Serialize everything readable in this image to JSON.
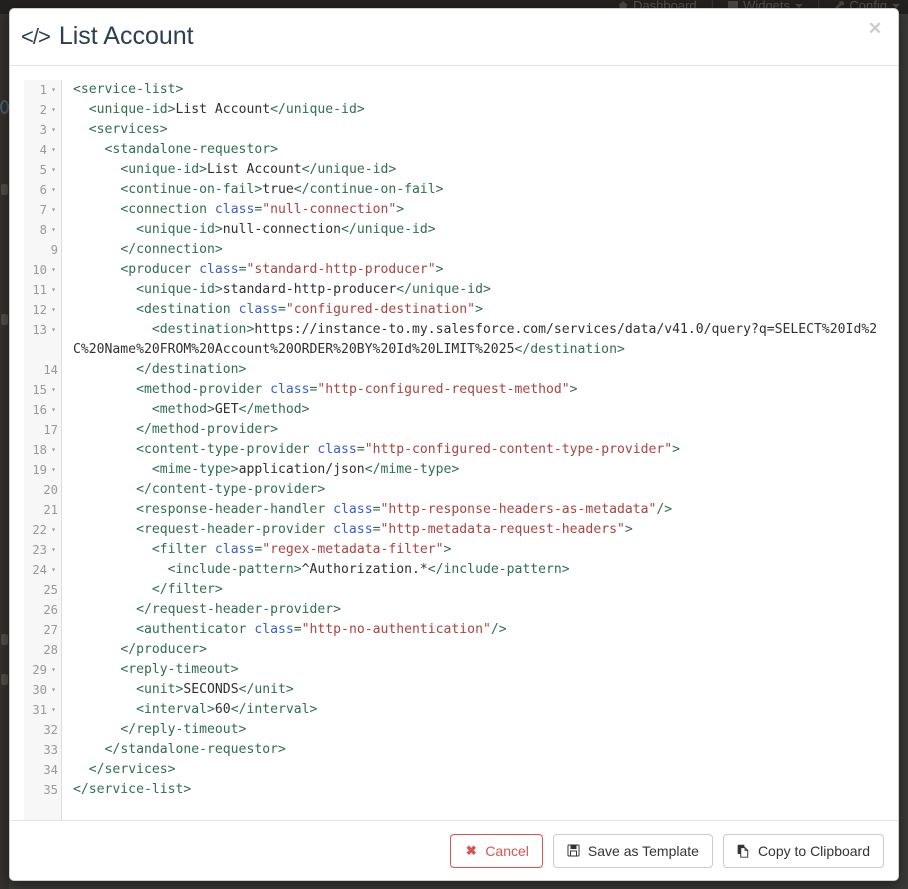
{
  "background": {
    "nav_items": [
      {
        "label": "Dashboard",
        "icon": "home-icon"
      },
      {
        "label": "Widgets",
        "icon": "widgets-icon"
      },
      {
        "label": "Config",
        "icon": "wrench-icon"
      }
    ],
    "separator": "|"
  },
  "modal": {
    "title": "List Account",
    "title_icon": "</>",
    "close_label": "✕"
  },
  "editor": {
    "language": "xml",
    "total_lines": 35,
    "lines": [
      {
        "n": 1,
        "fold": true,
        "indent": 0,
        "tokens": [
          {
            "t": "tag",
            "v": "<service-list>"
          }
        ]
      },
      {
        "n": 2,
        "fold": true,
        "indent": 1,
        "tokens": [
          {
            "t": "tag",
            "v": "<unique-id>"
          },
          {
            "t": "txt",
            "v": "List Account"
          },
          {
            "t": "tag",
            "v": "</unique-id>"
          }
        ]
      },
      {
        "n": 3,
        "fold": true,
        "indent": 1,
        "tokens": [
          {
            "t": "tag",
            "v": "<services>"
          }
        ]
      },
      {
        "n": 4,
        "fold": true,
        "indent": 2,
        "tokens": [
          {
            "t": "tag",
            "v": "<standalone-requestor>"
          }
        ]
      },
      {
        "n": 5,
        "fold": true,
        "indent": 3,
        "tokens": [
          {
            "t": "tag",
            "v": "<unique-id>"
          },
          {
            "t": "txt",
            "v": "List Account"
          },
          {
            "t": "tag",
            "v": "</unique-id>"
          }
        ]
      },
      {
        "n": 6,
        "fold": true,
        "indent": 3,
        "tokens": [
          {
            "t": "tag",
            "v": "<continue-on-fail>"
          },
          {
            "t": "txt",
            "v": "true"
          },
          {
            "t": "tag",
            "v": "</continue-on-fail>"
          }
        ]
      },
      {
        "n": 7,
        "fold": true,
        "indent": 3,
        "tokens": [
          {
            "t": "tag",
            "v": "<connection "
          },
          {
            "t": "attr",
            "v": "class"
          },
          {
            "t": "punc",
            "v": "="
          },
          {
            "t": "str",
            "v": "\"null-connection\""
          },
          {
            "t": "tag",
            "v": ">"
          }
        ]
      },
      {
        "n": 8,
        "fold": true,
        "indent": 4,
        "tokens": [
          {
            "t": "tag",
            "v": "<unique-id>"
          },
          {
            "t": "txt",
            "v": "null-connection"
          },
          {
            "t": "tag",
            "v": "</unique-id>"
          }
        ]
      },
      {
        "n": 9,
        "fold": false,
        "indent": 3,
        "tokens": [
          {
            "t": "tag",
            "v": "</connection>"
          }
        ]
      },
      {
        "n": 10,
        "fold": true,
        "indent": 3,
        "tokens": [
          {
            "t": "tag",
            "v": "<producer "
          },
          {
            "t": "attr",
            "v": "class"
          },
          {
            "t": "punc",
            "v": "="
          },
          {
            "t": "str",
            "v": "\"standard-http-producer\""
          },
          {
            "t": "tag",
            "v": ">"
          }
        ]
      },
      {
        "n": 11,
        "fold": true,
        "indent": 4,
        "tokens": [
          {
            "t": "tag",
            "v": "<unique-id>"
          },
          {
            "t": "txt",
            "v": "standard-http-producer"
          },
          {
            "t": "tag",
            "v": "</unique-id>"
          }
        ]
      },
      {
        "n": 12,
        "fold": true,
        "indent": 4,
        "tokens": [
          {
            "t": "tag",
            "v": "<destination "
          },
          {
            "t": "attr",
            "v": "class"
          },
          {
            "t": "punc",
            "v": "="
          },
          {
            "t": "str",
            "v": "\"configured-destination\""
          },
          {
            "t": "tag",
            "v": ">"
          }
        ]
      },
      {
        "n": 13,
        "fold": true,
        "indent": 5,
        "wraps": 2,
        "tokens": [
          {
            "t": "tag",
            "v": "<destination>"
          },
          {
            "t": "txt",
            "v": "https://instance-to.my.salesforce.com/services/data/v41.0/query?q=SELECT%20Id%2C%20Name%20FROM%20Account%20ORDER%20BY%20Id%20LIMIT%2025"
          },
          {
            "t": "tag",
            "v": "</destination>"
          }
        ]
      },
      {
        "n": 14,
        "fold": false,
        "indent": 4,
        "tokens": [
          {
            "t": "tag",
            "v": "</destination>"
          }
        ]
      },
      {
        "n": 15,
        "fold": true,
        "indent": 4,
        "tokens": [
          {
            "t": "tag",
            "v": "<method-provider "
          },
          {
            "t": "attr",
            "v": "class"
          },
          {
            "t": "punc",
            "v": "="
          },
          {
            "t": "str",
            "v": "\"http-configured-request-method\""
          },
          {
            "t": "tag",
            "v": ">"
          }
        ]
      },
      {
        "n": 16,
        "fold": true,
        "indent": 5,
        "tokens": [
          {
            "t": "tag",
            "v": "<method>"
          },
          {
            "t": "txt",
            "v": "GET"
          },
          {
            "t": "tag",
            "v": "</method>"
          }
        ]
      },
      {
        "n": 17,
        "fold": false,
        "indent": 4,
        "tokens": [
          {
            "t": "tag",
            "v": "</method-provider>"
          }
        ]
      },
      {
        "n": 18,
        "fold": true,
        "indent": 4,
        "tokens": [
          {
            "t": "tag",
            "v": "<content-type-provider "
          },
          {
            "t": "attr",
            "v": "class"
          },
          {
            "t": "punc",
            "v": "="
          },
          {
            "t": "str",
            "v": "\"http-configured-content-type-provider\""
          },
          {
            "t": "tag",
            "v": ">"
          }
        ]
      },
      {
        "n": 19,
        "fold": true,
        "indent": 5,
        "tokens": [
          {
            "t": "tag",
            "v": "<mime-type>"
          },
          {
            "t": "txt",
            "v": "application/json"
          },
          {
            "t": "tag",
            "v": "</mime-type>"
          }
        ]
      },
      {
        "n": 20,
        "fold": false,
        "indent": 4,
        "tokens": [
          {
            "t": "tag",
            "v": "</content-type-provider>"
          }
        ]
      },
      {
        "n": 21,
        "fold": false,
        "indent": 4,
        "tokens": [
          {
            "t": "tag",
            "v": "<response-header-handler "
          },
          {
            "t": "attr",
            "v": "class"
          },
          {
            "t": "punc",
            "v": "="
          },
          {
            "t": "str",
            "v": "\"http-response-headers-as-metadata\""
          },
          {
            "t": "tag",
            "v": "/>"
          }
        ]
      },
      {
        "n": 22,
        "fold": true,
        "indent": 4,
        "tokens": [
          {
            "t": "tag",
            "v": "<request-header-provider "
          },
          {
            "t": "attr",
            "v": "class"
          },
          {
            "t": "punc",
            "v": "="
          },
          {
            "t": "str",
            "v": "\"http-metadata-request-headers\""
          },
          {
            "t": "tag",
            "v": ">"
          }
        ]
      },
      {
        "n": 23,
        "fold": true,
        "indent": 5,
        "tokens": [
          {
            "t": "tag",
            "v": "<filter "
          },
          {
            "t": "attr",
            "v": "class"
          },
          {
            "t": "punc",
            "v": "="
          },
          {
            "t": "str",
            "v": "\"regex-metadata-filter\""
          },
          {
            "t": "tag",
            "v": ">"
          }
        ]
      },
      {
        "n": 24,
        "fold": true,
        "indent": 6,
        "tokens": [
          {
            "t": "tag",
            "v": "<include-pattern>"
          },
          {
            "t": "txt",
            "v": "^Authorization.*"
          },
          {
            "t": "tag",
            "v": "</include-pattern>"
          }
        ]
      },
      {
        "n": 25,
        "fold": false,
        "indent": 5,
        "tokens": [
          {
            "t": "tag",
            "v": "</filter>"
          }
        ]
      },
      {
        "n": 26,
        "fold": false,
        "indent": 4,
        "tokens": [
          {
            "t": "tag",
            "v": "</request-header-provider>"
          }
        ]
      },
      {
        "n": 27,
        "fold": false,
        "indent": 4,
        "tokens": [
          {
            "t": "tag",
            "v": "<authenticator "
          },
          {
            "t": "attr",
            "v": "class"
          },
          {
            "t": "punc",
            "v": "="
          },
          {
            "t": "str",
            "v": "\"http-no-authentication\""
          },
          {
            "t": "tag",
            "v": "/>"
          }
        ]
      },
      {
        "n": 28,
        "fold": false,
        "indent": 3,
        "tokens": [
          {
            "t": "tag",
            "v": "</producer>"
          }
        ]
      },
      {
        "n": 29,
        "fold": true,
        "indent": 3,
        "tokens": [
          {
            "t": "tag",
            "v": "<reply-timeout>"
          }
        ]
      },
      {
        "n": 30,
        "fold": true,
        "indent": 4,
        "tokens": [
          {
            "t": "tag",
            "v": "<unit>"
          },
          {
            "t": "txt",
            "v": "SECONDS"
          },
          {
            "t": "tag",
            "v": "</unit>"
          }
        ]
      },
      {
        "n": 31,
        "fold": true,
        "indent": 4,
        "tokens": [
          {
            "t": "tag",
            "v": "<interval>"
          },
          {
            "t": "txt",
            "v": "60"
          },
          {
            "t": "tag",
            "v": "</interval>"
          }
        ]
      },
      {
        "n": 32,
        "fold": false,
        "indent": 3,
        "tokens": [
          {
            "t": "tag",
            "v": "</reply-timeout>"
          }
        ]
      },
      {
        "n": 33,
        "fold": false,
        "indent": 2,
        "tokens": [
          {
            "t": "tag",
            "v": "</standalone-requestor>"
          }
        ]
      },
      {
        "n": 34,
        "fold": false,
        "indent": 1,
        "tokens": [
          {
            "t": "tag",
            "v": "</services>"
          }
        ]
      },
      {
        "n": 35,
        "fold": false,
        "indent": 0,
        "tokens": [
          {
            "t": "tag",
            "v": "</service-list>"
          }
        ]
      }
    ]
  },
  "footer": {
    "buttons": [
      {
        "id": "cancel",
        "label": "Cancel",
        "icon": "times-icon",
        "style": "danger-outline"
      },
      {
        "id": "save-as-template",
        "label": "Save as Template",
        "icon": "save-icon",
        "style": "default"
      },
      {
        "id": "copy-to-clipboard",
        "label": "Copy to Clipboard",
        "icon": "copy-icon",
        "style": "default"
      }
    ]
  },
  "colors": {
    "tag": "#2f6f4f",
    "attribute": "#3a5fcd",
    "string": "#a94442",
    "text": "#303030",
    "title": "#2c3e50",
    "danger": "#d9534f",
    "gutter_bg": "#f7f7f7",
    "gutter_text": "#999999"
  }
}
